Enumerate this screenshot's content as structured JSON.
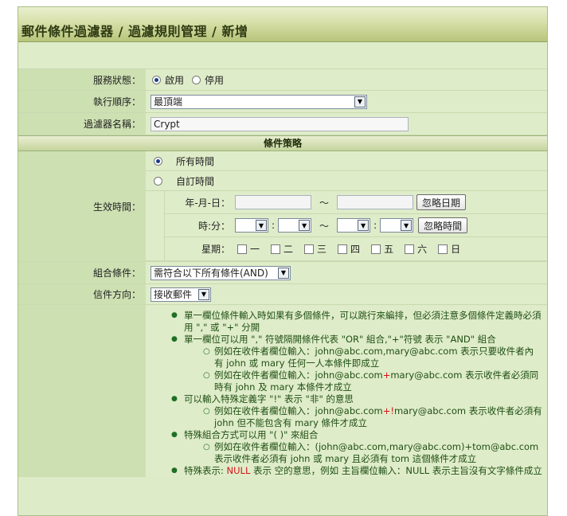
{
  "title": "郵件條件過濾器 / 過濾規則管理 / 新增",
  "status": {
    "label": "服務狀態：",
    "on_label": "啟用",
    "off_label": "停用",
    "selected": "啟用"
  },
  "order": {
    "label": "執行順序：",
    "value": "最頂端"
  },
  "name": {
    "label": "過濾器名稱：",
    "value": "Crypt"
  },
  "section_title": "條件策略",
  "effective": {
    "label": "生效時間：",
    "all_time": "所有時間",
    "custom_time": "自訂時間",
    "date_label": "年-月-日：",
    "tilde": "～",
    "ignore_date": "忽略日期",
    "time_label": "時:分：",
    "colon": ":",
    "ignore_time": "忽略時間",
    "weekday_label": "星期：",
    "weekdays": [
      "一",
      "二",
      "三",
      "四",
      "五",
      "六",
      "日"
    ]
  },
  "combine": {
    "label": "組合條件：",
    "value": "需符合以下所有條件(AND)"
  },
  "direction": {
    "label": "信件方向：",
    "value": "接收郵件"
  },
  "notes": {
    "n1": "單一欄位條件輸入時如果有多個條件，可以跳行來編排，但必須注意多個條件定義時必須用 \",\" 或 \"+\" 分開",
    "n2": "單一欄位可以用 \",\" 符號隔開條件代表 \"OR\" 組合,\"+\"符號 表示 \"AND\" 組合",
    "n2a": "例如在收件者欄位輸入：john@abc.com,mary@abc.com 表示只要收件者內有 john 或 mary 任何一人本條件即成立",
    "n2b_pre": "例如在收件者欄位輸入：john@abc.com",
    "n2b_plus": "+",
    "n2b_post": "mary@abc.com 表示收件者必須同時有 john 及 mary 本條件才成立",
    "n3": "可以輸入特殊定義字 \"!\" 表示 \"非\" 的意思",
    "n3a_pre": "例如在收件者欄位輸入：john@abc.com",
    "n3a_mark": "+!",
    "n3a_post": "mary@abc.com 表示收件者必須有 john 但不能包含有 mary 條件才成立",
    "n4": "特殊組合方式可以用 \"( )\" 來組合",
    "n4a": "例如在收件者欄位輸入：(john@abc.com,mary@abc.com)+tom@abc.com 表示收件者必須有 john 或 mary 且必須有 tom 這個條件才成立",
    "n5_pre": "特殊表示: ",
    "n5_null": "NULL",
    "n5_post": " 表示 空的意思，例如 主旨欄位輸入：NULL 表示主旨沒有文字條件成立"
  }
}
